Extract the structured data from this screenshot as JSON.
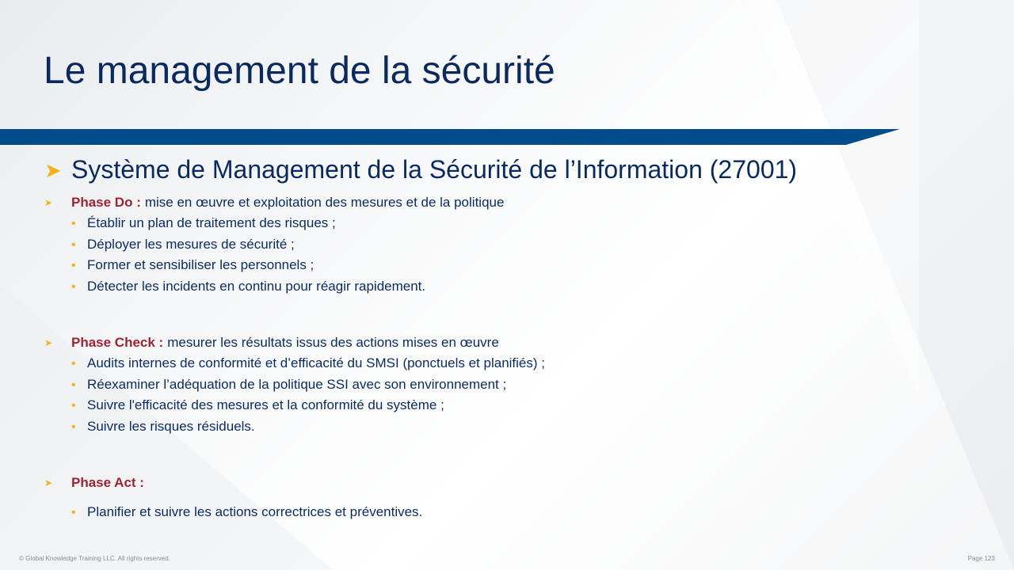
{
  "slide": {
    "title": "Le management de la sécurité",
    "main_heading": "Système de Management  de la Sécurité de l’Information (27001)",
    "phases": [
      {
        "name": "Phase Do :",
        "description": "mise en œuvre et exploitation des mesures et de la politique",
        "items": [
          "Établir un plan de traitement des risques ;",
          "Déployer les mesures de sécurité ;",
          "Former et sensibiliser les personnels ;",
          "Détecter les incidents en continu pour réagir rapidement."
        ]
      },
      {
        "name": "Phase Check :",
        "description": "mesurer les résultats issus des actions mises en œuvre",
        "items": [
          "Audits internes de conformité et d’efficacité du SMSI (ponctuels et planifiés) ;",
          "Réexaminer l’adéquation de la politique SSI avec son environnement ;",
          "Suivre l'efficacité des mesures et la conformité du système ;",
          "Suivre les risques résiduels."
        ]
      },
      {
        "name": "Phase Act :",
        "description": "",
        "items": [
          "Planifier et suivre les actions correctrices et préventives."
        ]
      }
    ]
  },
  "footer": {
    "copyright": "© Global Knowledge  Training LLC. All rights reserved.",
    "page_label": "Page  123"
  },
  "colors": {
    "title": "#0a2a5e",
    "banner": "#004c8a",
    "accent_arrow": "#f2b11d",
    "phase_name": "#9b2433"
  },
  "icons": {
    "main_bullet": "arrowhead-icon",
    "sub_bullet": "dot-icon"
  }
}
